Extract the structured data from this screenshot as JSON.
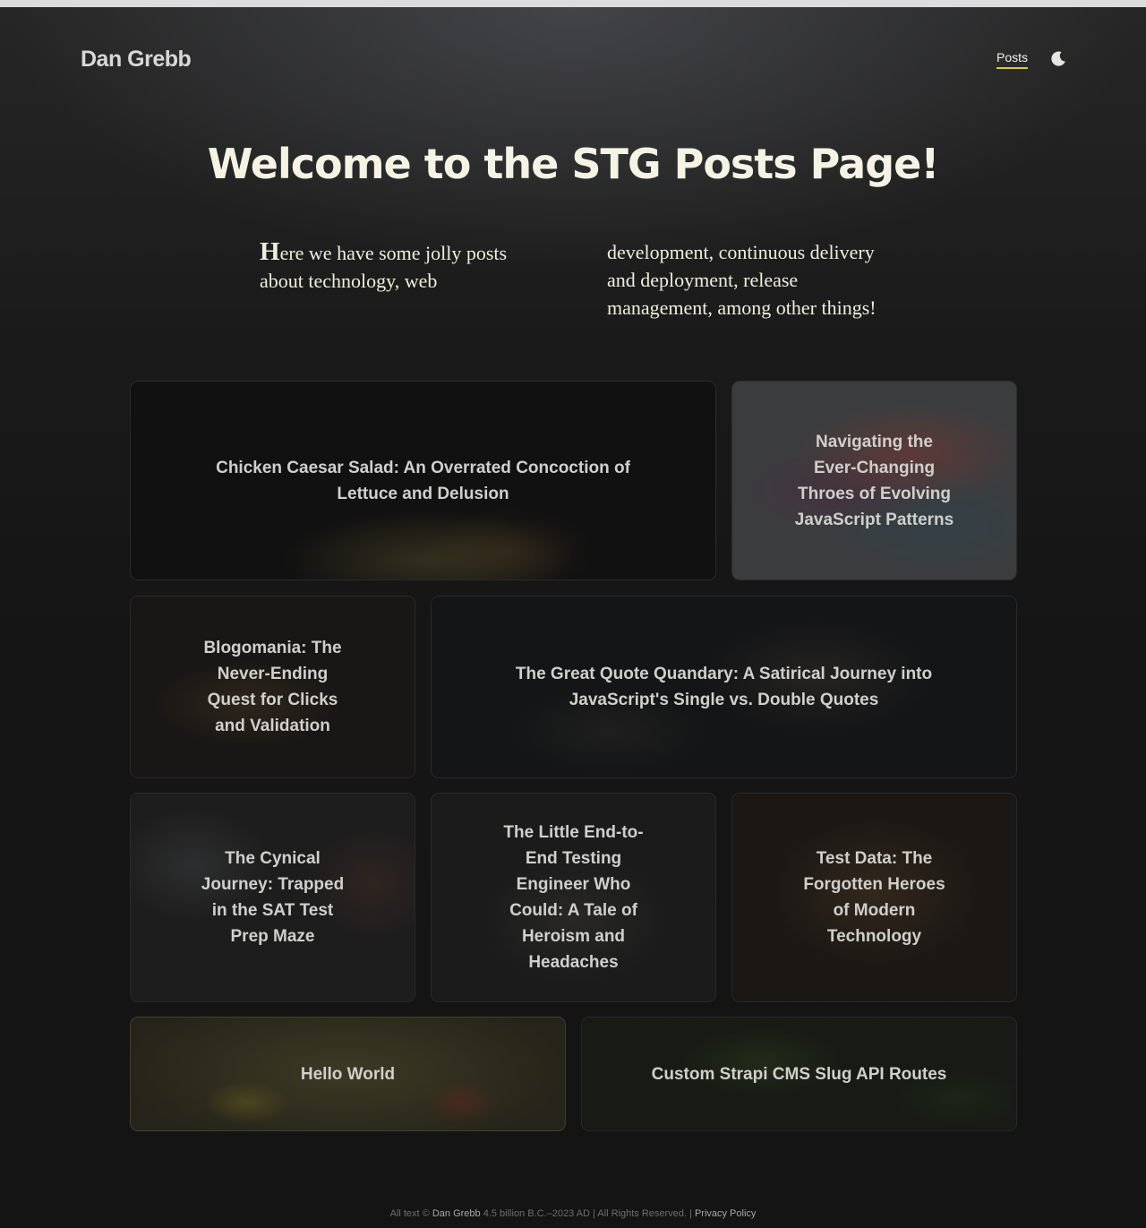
{
  "header": {
    "brand": "Dan Grebb",
    "nav": {
      "posts_label": "Posts"
    },
    "theme_toggle_icon": "moon-icon",
    "accent_color": "#d9c94a"
  },
  "hero": {
    "title": "Welcome to the STG Posts Page!",
    "intro_first_letter": "H",
    "intro_rest": "ere we have some jolly posts about technology, web development, continuous delivery and deployment, release management, among other things!"
  },
  "posts": [
    {
      "title": "Chicken Caesar Salad: An Overrated Concoction of Lettuce and Delusion"
    },
    {
      "title": "Navigating the Ever-Changing Throes of Evolving JavaScript Patterns"
    },
    {
      "title": "Blogomania: The Never-Ending Quest for Clicks and Validation"
    },
    {
      "title": "The Great Quote Quandary: A Satirical Journey into JavaScript's Single vs. Double Quotes"
    },
    {
      "title": "The Cynical Journey: Trapped in the SAT Test Prep Maze"
    },
    {
      "title": "The Little End-to-End Testing Engineer Who Could: A Tale of Heroism and Headaches"
    },
    {
      "title": "Test Data: The Forgotten Heroes of Modern Technology"
    },
    {
      "title": "Hello World"
    },
    {
      "title": "Custom Strapi CMS Slug API Routes"
    }
  ],
  "footer": {
    "prefix": "All text ©",
    "author": "Dan Grebb",
    "span": "4.5 billion B.C.–2023 AD | All Rights Reserved. |",
    "privacy_label": "Privacy Policy"
  }
}
